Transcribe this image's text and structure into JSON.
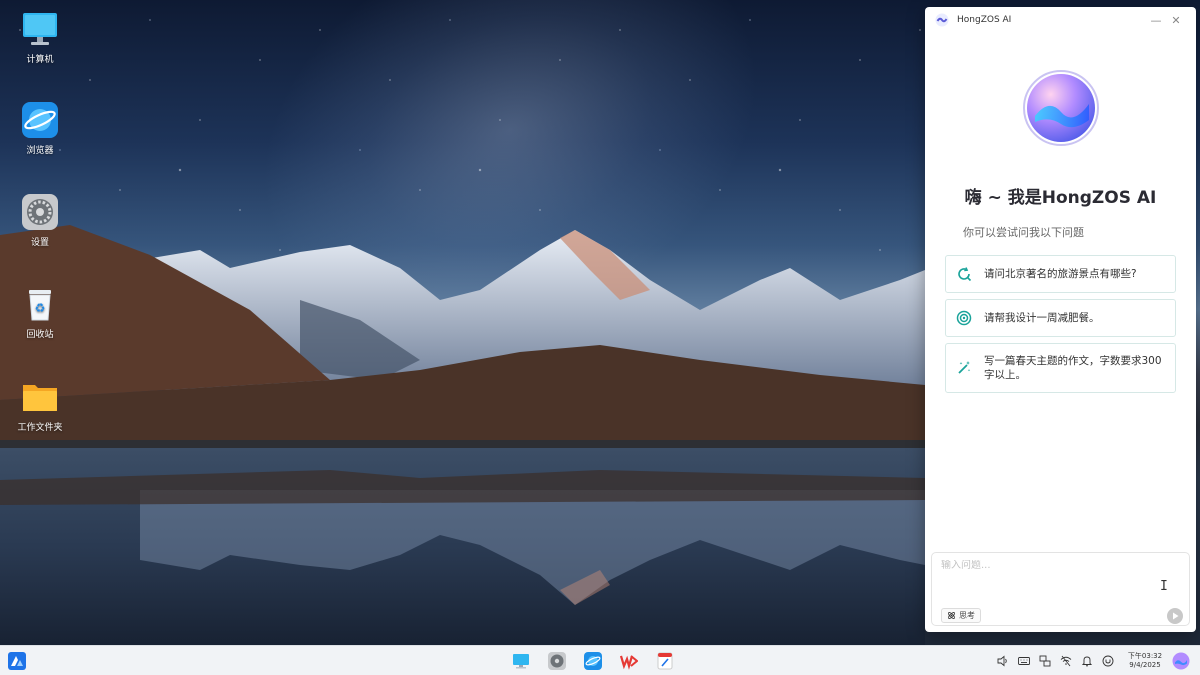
{
  "desktop": {
    "icons": [
      {
        "label": "计算机",
        "icon": "computer-icon"
      },
      {
        "label": "浏览器",
        "icon": "browser-icon"
      },
      {
        "label": "设置",
        "icon": "settings-gear-icon"
      },
      {
        "label": "回收站",
        "icon": "recycle-bin-icon"
      },
      {
        "label": "工作文件夹",
        "icon": "folder-icon"
      }
    ]
  },
  "ai_panel": {
    "title": "HongZOS AI",
    "greeting": "嗨 ~ 我是HongZOS AI",
    "subtitle": "你可以尝试问我以下问题",
    "suggestions": [
      {
        "text": "请问北京著名的旅游景点有哪些?",
        "icon": "search-refresh-icon"
      },
      {
        "text": "请帮我设计一周减肥餐。",
        "icon": "target-icon"
      },
      {
        "text": "写一篇春天主题的作文，字数要求300字以上。",
        "icon": "magic-wand-icon"
      }
    ],
    "input_placeholder": "输入问题...",
    "think_label": "思考",
    "colors": {
      "accent_border": "#d6e8e6",
      "icon_teal": "#1aa39a"
    }
  },
  "taskbar": {
    "apps": [
      "monitor-icon",
      "settings-gear-icon",
      "browser-icon",
      "wps-icon",
      "notes-icon"
    ],
    "tray": [
      "volume-icon",
      "keyboard-icon",
      "network-icon",
      "wifi-icon",
      "bell-icon",
      "power-icon"
    ],
    "clock_ampm_time": "下午03:32",
    "clock_date": "9/4/2025"
  }
}
